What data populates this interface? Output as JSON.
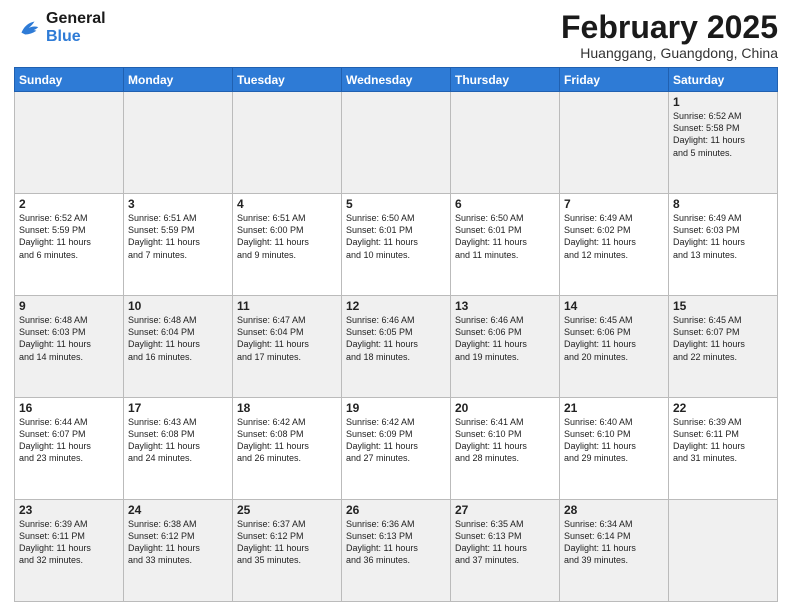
{
  "header": {
    "logo_line1": "General",
    "logo_line2": "Blue",
    "month_title": "February 2025",
    "location": "Huanggang, Guangdong, China"
  },
  "days_of_week": [
    "Sunday",
    "Monday",
    "Tuesday",
    "Wednesday",
    "Thursday",
    "Friday",
    "Saturday"
  ],
  "weeks": [
    [
      {
        "day": "",
        "info": ""
      },
      {
        "day": "",
        "info": ""
      },
      {
        "day": "",
        "info": ""
      },
      {
        "day": "",
        "info": ""
      },
      {
        "day": "",
        "info": ""
      },
      {
        "day": "",
        "info": ""
      },
      {
        "day": "1",
        "info": "Sunrise: 6:52 AM\nSunset: 5:58 PM\nDaylight: 11 hours\nand 5 minutes."
      }
    ],
    [
      {
        "day": "2",
        "info": "Sunrise: 6:52 AM\nSunset: 5:59 PM\nDaylight: 11 hours\nand 6 minutes."
      },
      {
        "day": "3",
        "info": "Sunrise: 6:51 AM\nSunset: 5:59 PM\nDaylight: 11 hours\nand 7 minutes."
      },
      {
        "day": "4",
        "info": "Sunrise: 6:51 AM\nSunset: 6:00 PM\nDaylight: 11 hours\nand 9 minutes."
      },
      {
        "day": "5",
        "info": "Sunrise: 6:50 AM\nSunset: 6:01 PM\nDaylight: 11 hours\nand 10 minutes."
      },
      {
        "day": "6",
        "info": "Sunrise: 6:50 AM\nSunset: 6:01 PM\nDaylight: 11 hours\nand 11 minutes."
      },
      {
        "day": "7",
        "info": "Sunrise: 6:49 AM\nSunset: 6:02 PM\nDaylight: 11 hours\nand 12 minutes."
      },
      {
        "day": "8",
        "info": "Sunrise: 6:49 AM\nSunset: 6:03 PM\nDaylight: 11 hours\nand 13 minutes."
      }
    ],
    [
      {
        "day": "9",
        "info": "Sunrise: 6:48 AM\nSunset: 6:03 PM\nDaylight: 11 hours\nand 14 minutes."
      },
      {
        "day": "10",
        "info": "Sunrise: 6:48 AM\nSunset: 6:04 PM\nDaylight: 11 hours\nand 16 minutes."
      },
      {
        "day": "11",
        "info": "Sunrise: 6:47 AM\nSunset: 6:04 PM\nDaylight: 11 hours\nand 17 minutes."
      },
      {
        "day": "12",
        "info": "Sunrise: 6:46 AM\nSunset: 6:05 PM\nDaylight: 11 hours\nand 18 minutes."
      },
      {
        "day": "13",
        "info": "Sunrise: 6:46 AM\nSunset: 6:06 PM\nDaylight: 11 hours\nand 19 minutes."
      },
      {
        "day": "14",
        "info": "Sunrise: 6:45 AM\nSunset: 6:06 PM\nDaylight: 11 hours\nand 20 minutes."
      },
      {
        "day": "15",
        "info": "Sunrise: 6:45 AM\nSunset: 6:07 PM\nDaylight: 11 hours\nand 22 minutes."
      }
    ],
    [
      {
        "day": "16",
        "info": "Sunrise: 6:44 AM\nSunset: 6:07 PM\nDaylight: 11 hours\nand 23 minutes."
      },
      {
        "day": "17",
        "info": "Sunrise: 6:43 AM\nSunset: 6:08 PM\nDaylight: 11 hours\nand 24 minutes."
      },
      {
        "day": "18",
        "info": "Sunrise: 6:42 AM\nSunset: 6:08 PM\nDaylight: 11 hours\nand 26 minutes."
      },
      {
        "day": "19",
        "info": "Sunrise: 6:42 AM\nSunset: 6:09 PM\nDaylight: 11 hours\nand 27 minutes."
      },
      {
        "day": "20",
        "info": "Sunrise: 6:41 AM\nSunset: 6:10 PM\nDaylight: 11 hours\nand 28 minutes."
      },
      {
        "day": "21",
        "info": "Sunrise: 6:40 AM\nSunset: 6:10 PM\nDaylight: 11 hours\nand 29 minutes."
      },
      {
        "day": "22",
        "info": "Sunrise: 6:39 AM\nSunset: 6:11 PM\nDaylight: 11 hours\nand 31 minutes."
      }
    ],
    [
      {
        "day": "23",
        "info": "Sunrise: 6:39 AM\nSunset: 6:11 PM\nDaylight: 11 hours\nand 32 minutes."
      },
      {
        "day": "24",
        "info": "Sunrise: 6:38 AM\nSunset: 6:12 PM\nDaylight: 11 hours\nand 33 minutes."
      },
      {
        "day": "25",
        "info": "Sunrise: 6:37 AM\nSunset: 6:12 PM\nDaylight: 11 hours\nand 35 minutes."
      },
      {
        "day": "26",
        "info": "Sunrise: 6:36 AM\nSunset: 6:13 PM\nDaylight: 11 hours\nand 36 minutes."
      },
      {
        "day": "27",
        "info": "Sunrise: 6:35 AM\nSunset: 6:13 PM\nDaylight: 11 hours\nand 37 minutes."
      },
      {
        "day": "28",
        "info": "Sunrise: 6:34 AM\nSunset: 6:14 PM\nDaylight: 11 hours\nand 39 minutes."
      },
      {
        "day": "",
        "info": ""
      }
    ]
  ]
}
